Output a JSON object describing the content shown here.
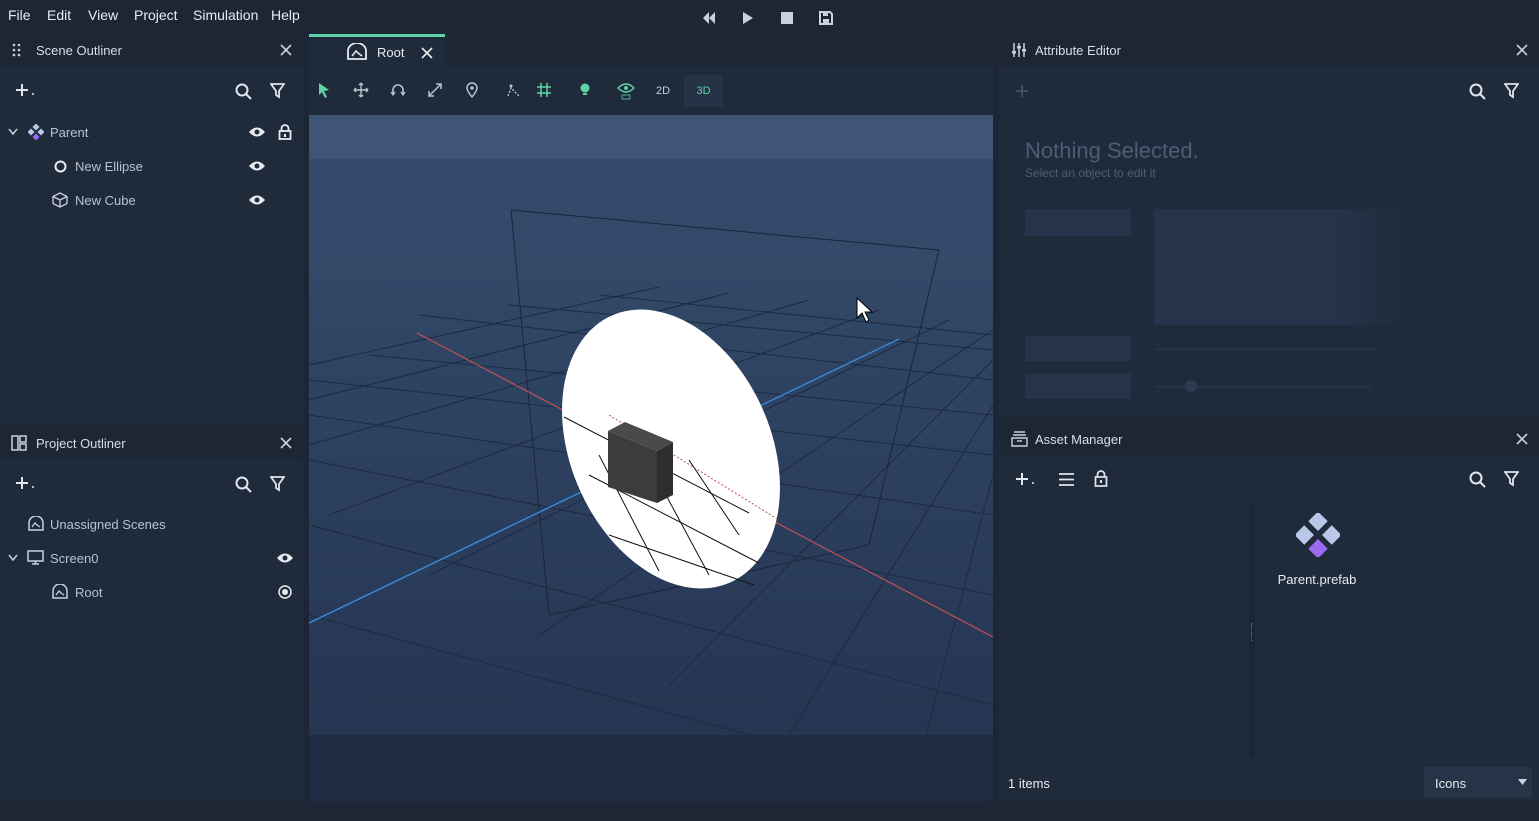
{
  "menu": {
    "items": [
      "File",
      "Edit",
      "View",
      "Project",
      "Simulation",
      "Help"
    ]
  },
  "scene_outliner": {
    "title": "Scene Outliner",
    "tree": [
      {
        "label": "Parent",
        "icon": "prefab-icon"
      },
      {
        "label": "New Ellipse",
        "icon": "ellipse-icon"
      },
      {
        "label": "New Cube",
        "icon": "cube-icon"
      }
    ]
  },
  "project_outliner": {
    "title": "Project Outliner",
    "tree": [
      {
        "label": "Unassigned Scenes",
        "icon": "scene-icon"
      },
      {
        "label": "Screen0",
        "icon": "monitor-icon"
      },
      {
        "label": "Root",
        "icon": "scene-icon"
      }
    ]
  },
  "viewport": {
    "tab_label": "Root",
    "mode_2d": "2D",
    "mode_3d": "3D",
    "tools": [
      "select-icon",
      "move-icon",
      "rotate-icon",
      "scale-icon",
      "pin-icon",
      "snap-icon",
      "grid-icon",
      "light-icon",
      "visibility-icon"
    ]
  },
  "attribute_editor": {
    "title": "Attribute Editor",
    "empty_title": "Nothing Selected.",
    "empty_subtitle": "Select an object to edit it"
  },
  "asset_manager": {
    "title": "Asset Manager",
    "assets": [
      {
        "label": "Parent.prefab",
        "icon": "prefab-icon"
      }
    ],
    "count_text": "1 items",
    "view_mode": "Icons"
  },
  "colors": {
    "accent": "#5fd3a8",
    "prefab": "#b9c8e8",
    "prefab_purple": "#9b6cf0"
  }
}
